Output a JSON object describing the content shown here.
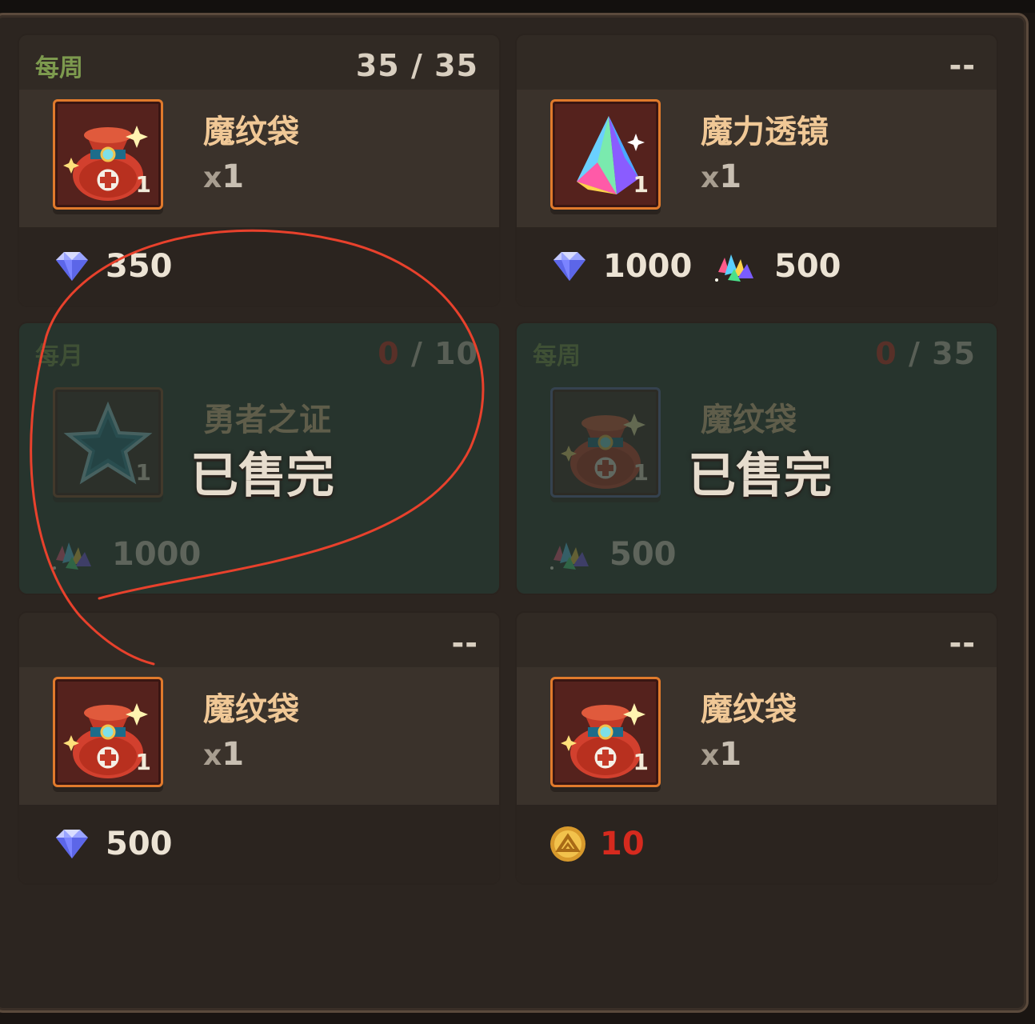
{
  "cards": [
    {
      "tag": "每周",
      "limit_current": "35",
      "limit_sep": "/",
      "limit_max": "35",
      "item_name": "魔纹袋",
      "item_count_prefix": "x",
      "item_count": "1",
      "slot_qty": "1",
      "icon": "magic-pattern-bag-icon",
      "prices": [
        {
          "currency_icon": "diamond-icon",
          "amount": "350"
        }
      ],
      "sold_out": false
    },
    {
      "tag": "",
      "limit_text": "--",
      "item_name": "魔力透镜",
      "item_count_prefix": "x",
      "item_count": "1",
      "slot_qty": "1",
      "icon": "magic-lens-prism-icon",
      "prices": [
        {
          "currency_icon": "diamond-icon",
          "amount": "1000"
        },
        {
          "currency_icon": "crystal-shards-icon",
          "amount": "500"
        }
      ],
      "sold_out": false
    },
    {
      "tag": "每月",
      "limit_current": "0",
      "limit_sep": "/",
      "limit_max": "10",
      "item_name": "勇者之证",
      "slot_qty": "1",
      "icon": "star-badge-icon",
      "prices": [
        {
          "currency_icon": "crystal-shards-icon",
          "amount": "1000"
        }
      ],
      "sold_out": true,
      "sold_out_label": "已售完"
    },
    {
      "tag": "每周",
      "limit_current": "0",
      "limit_sep": "/",
      "limit_max": "35",
      "item_name": "魔纹袋",
      "slot_qty": "1",
      "icon": "magic-pattern-bag-icon",
      "prices": [
        {
          "currency_icon": "crystal-shards-icon",
          "amount": "500"
        }
      ],
      "sold_out": true,
      "sold_out_label": "已售完"
    },
    {
      "tag": "",
      "limit_text": "--",
      "item_name": "魔纹袋",
      "item_count_prefix": "x",
      "item_count": "1",
      "slot_qty": "1",
      "icon": "magic-pattern-bag-icon",
      "prices": [
        {
          "currency_icon": "diamond-icon",
          "amount": "500"
        }
      ],
      "sold_out": false
    },
    {
      "tag": "",
      "limit_text": "--",
      "item_name": "魔纹袋",
      "item_count_prefix": "x",
      "item_count": "1",
      "slot_qty": "1",
      "icon": "magic-pattern-bag-icon",
      "prices": [
        {
          "currency_icon": "gold-coin-icon",
          "amount": "10",
          "insufficient": true
        }
      ],
      "sold_out": false
    }
  ],
  "colors": {
    "tag_green": "#7d9a4e",
    "item_name_gold": "#f0c896",
    "insufficient_red": "#d62a1e",
    "slot_border_orange": "#e07a2c",
    "annotation_red": "#e8412c"
  }
}
